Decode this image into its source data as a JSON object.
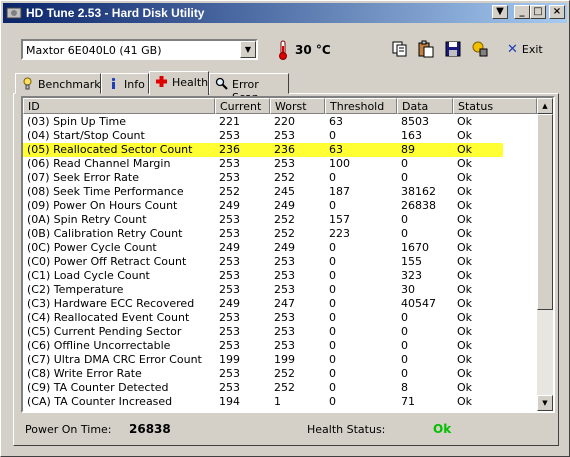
{
  "window": {
    "title": "HD Tune 2.53 - Hard Disk Utility",
    "controls": {
      "down": "▼",
      "minimize": "_",
      "maximize": "□",
      "close": "×"
    }
  },
  "toolbar": {
    "drive": "Maxtor 6E040L0 (41 GB)",
    "temperature": "30 °C",
    "exit_label": "Exit",
    "icons": [
      "copy-icon",
      "paste-icon",
      "save-icon",
      "options-icon"
    ]
  },
  "tabs": [
    {
      "label": "Benchmark",
      "icon": "benchmark-icon",
      "active": false
    },
    {
      "label": "Info",
      "icon": "info-icon",
      "active": false
    },
    {
      "label": "Health",
      "icon": "health-icon",
      "active": true
    },
    {
      "label": "Error Scan",
      "icon": "error-scan-icon",
      "active": false
    }
  ],
  "table": {
    "columns": [
      "ID",
      "Current",
      "Worst",
      "Threshold",
      "Data",
      "Status"
    ],
    "highlight_color": "#ffff33",
    "rows": [
      {
        "id": "(03) Spin Up Time",
        "current": "221",
        "worst": "220",
        "threshold": "63",
        "data": "8503",
        "status": "Ok"
      },
      {
        "id": "(04) Start/Stop Count",
        "current": "253",
        "worst": "253",
        "threshold": "0",
        "data": "163",
        "status": "Ok"
      },
      {
        "id": "(05) Reallocated Sector Count",
        "current": "236",
        "worst": "236",
        "threshold": "63",
        "data": "89",
        "status": "Ok",
        "highlight": true
      },
      {
        "id": "(06) Read Channel Margin",
        "current": "253",
        "worst": "253",
        "threshold": "100",
        "data": "0",
        "status": "Ok"
      },
      {
        "id": "(07) Seek Error Rate",
        "current": "253",
        "worst": "252",
        "threshold": "0",
        "data": "0",
        "status": "Ok"
      },
      {
        "id": "(08) Seek Time Performance",
        "current": "252",
        "worst": "245",
        "threshold": "187",
        "data": "38162",
        "status": "Ok"
      },
      {
        "id": "(09) Power On Hours Count",
        "current": "249",
        "worst": "249",
        "threshold": "0",
        "data": "26838",
        "status": "Ok"
      },
      {
        "id": "(0A) Spin Retry Count",
        "current": "253",
        "worst": "252",
        "threshold": "157",
        "data": "0",
        "status": "Ok"
      },
      {
        "id": "(0B) Calibration Retry Count",
        "current": "253",
        "worst": "252",
        "threshold": "223",
        "data": "0",
        "status": "Ok"
      },
      {
        "id": "(0C) Power Cycle Count",
        "current": "249",
        "worst": "249",
        "threshold": "0",
        "data": "1670",
        "status": "Ok"
      },
      {
        "id": "(C0) Power Off Retract Count",
        "current": "253",
        "worst": "253",
        "threshold": "0",
        "data": "155",
        "status": "Ok"
      },
      {
        "id": "(C1) Load Cycle Count",
        "current": "253",
        "worst": "253",
        "threshold": "0",
        "data": "323",
        "status": "Ok"
      },
      {
        "id": "(C2) Temperature",
        "current": "253",
        "worst": "253",
        "threshold": "0",
        "data": "30",
        "status": "Ok"
      },
      {
        "id": "(C3) Hardware ECC Recovered",
        "current": "249",
        "worst": "247",
        "threshold": "0",
        "data": "40547",
        "status": "Ok"
      },
      {
        "id": "(C4) Reallocated Event Count",
        "current": "253",
        "worst": "253",
        "threshold": "0",
        "data": "0",
        "status": "Ok"
      },
      {
        "id": "(C5) Current Pending Sector",
        "current": "253",
        "worst": "253",
        "threshold": "0",
        "data": "0",
        "status": "Ok"
      },
      {
        "id": "(C6) Offline Uncorrectable",
        "current": "253",
        "worst": "253",
        "threshold": "0",
        "data": "0",
        "status": "Ok"
      },
      {
        "id": "(C7) Ultra DMA CRC Error Count",
        "current": "199",
        "worst": "199",
        "threshold": "0",
        "data": "0",
        "status": "Ok"
      },
      {
        "id": "(C8) Write Error Rate",
        "current": "253",
        "worst": "252",
        "threshold": "0",
        "data": "0",
        "status": "Ok"
      },
      {
        "id": "(C9) TA Counter Detected",
        "current": "253",
        "worst": "252",
        "threshold": "0",
        "data": "8",
        "status": "Ok"
      },
      {
        "id": "(CA) TA Counter Increased",
        "current": "194",
        "worst": "1",
        "threshold": "0",
        "data": "71",
        "status": "Ok"
      }
    ]
  },
  "status": {
    "power_on_label": "Power On Time:",
    "power_on_value": "26838",
    "health_label": "Health Status:",
    "health_value": "Ok",
    "health_color": "#00c000"
  }
}
